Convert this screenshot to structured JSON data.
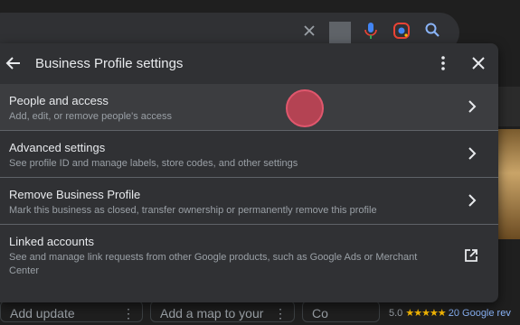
{
  "dialog": {
    "title": "Business Profile settings",
    "rows": [
      {
        "title": "People and access",
        "desc": "Add, edit, or remove people's access",
        "action": "chevron-right-icon"
      },
      {
        "title": "Advanced settings",
        "desc": "See profile ID and manage labels, store codes, and other settings",
        "action": "chevron-right-icon"
      },
      {
        "title": "Remove Business Profile",
        "desc": "Mark this business as closed, transfer ownership or permanently remove this profile",
        "action": "chevron-right-icon"
      },
      {
        "title": "Linked accounts",
        "desc": "See and manage link requests from other Google products, such as Google Ads or Merchant Center",
        "action": "open-in-new-icon"
      }
    ]
  },
  "background": {
    "bottom_cards": [
      "Add update",
      "Add a map to your",
      "Co"
    ],
    "rating": {
      "score": "5.0",
      "stars": "★★★★★",
      "reviews": "20 Google rev"
    }
  },
  "colors": {
    "dialog_bg": "#303134",
    "selected_row_bg": "#3c3d40",
    "touch_indicator": "#e0576d",
    "star": "#fbbc04",
    "link": "#8ab4f8"
  }
}
